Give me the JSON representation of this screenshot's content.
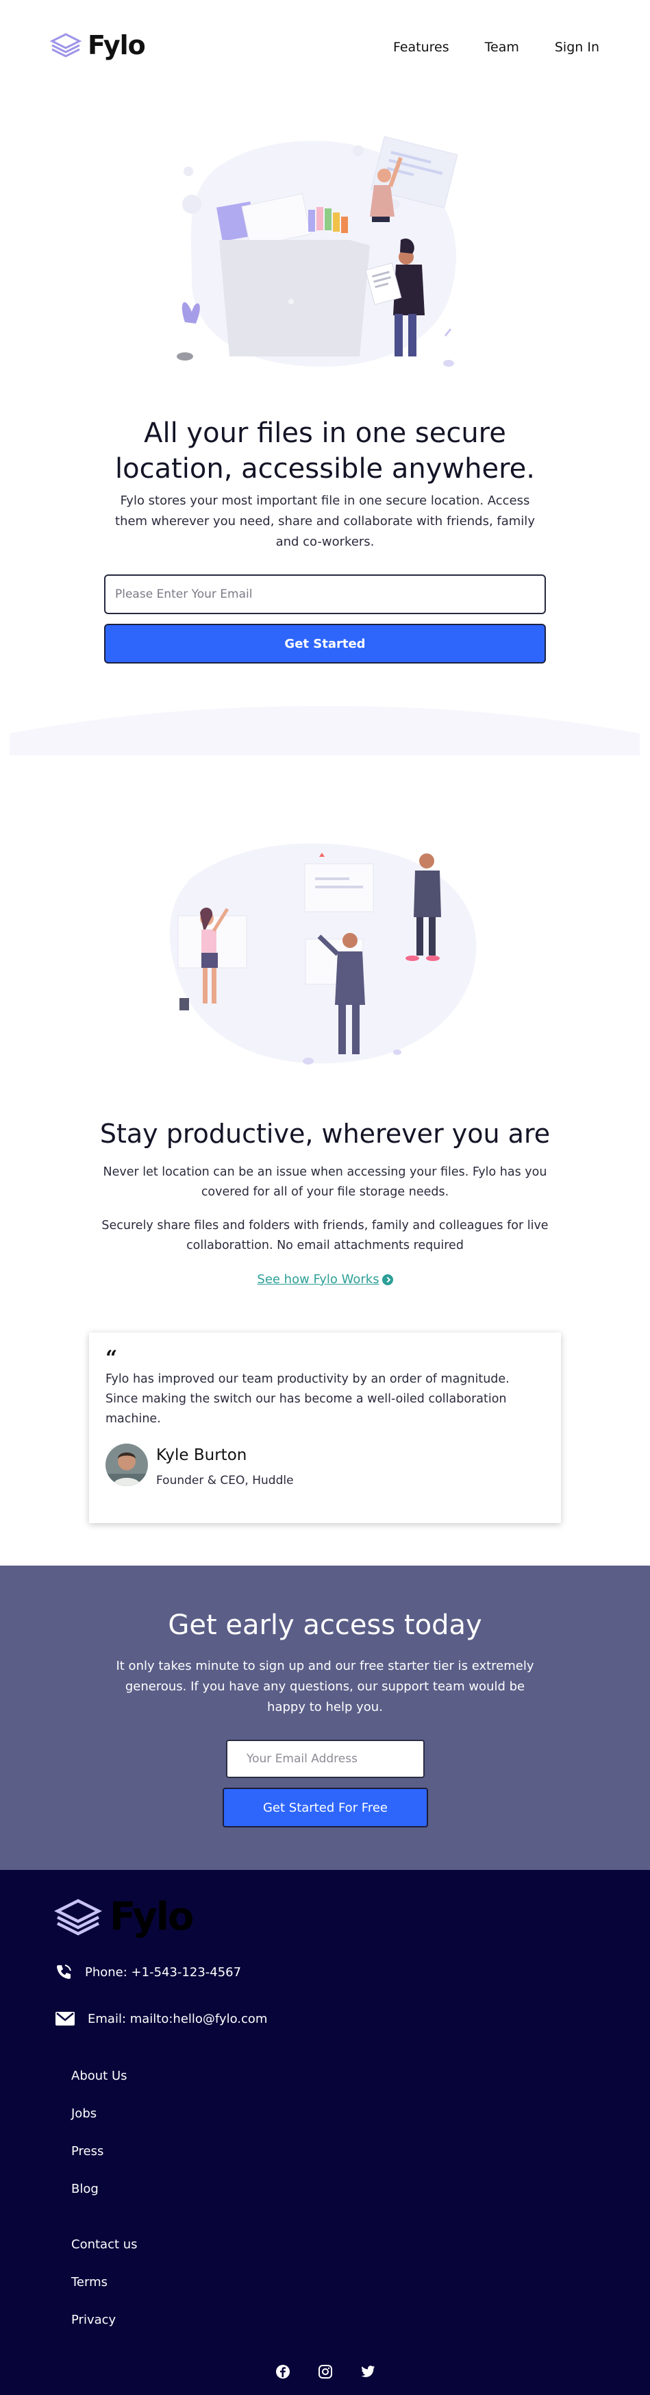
{
  "header": {
    "logo_text": "Fylo",
    "nav": [
      "Features",
      "Team",
      "Sign In"
    ]
  },
  "hero": {
    "title_line1": "All your files in one secure",
    "title_line2": "location, accessible anywhere.",
    "subtitle": "Fylo stores your most important file in one secure location. Access them wherever you need, share and collaborate with friends, family and co-workers.",
    "email_placeholder": "Please Enter Your Email",
    "button_label": "Get Started"
  },
  "productive": {
    "title": "Stay productive, wherever you are",
    "paragraph1": "Never let location can be an issue when accessing your files. Fylo has you covered for all of your file storage needs.",
    "paragraph2": "Securely share files and folders with friends, family and colleagues for live collaborattion. No email attachments required",
    "link_text": "See how Fylo Works"
  },
  "testimonial": {
    "quote_mark": "“",
    "quote": "Fylo has improved our team productivity by an order of magnitude. Since making the switch our has become a well-oiled collaboration machine.",
    "name": "Kyle Burton",
    "role": "Founder & CEO, Huddle"
  },
  "cta": {
    "title": "Get early access today",
    "text": "It only takes minute to sign up and our free starter tier is extremely generous. If you have any questions, our support team would be happy to help you.",
    "email_placeholder": "Your Email Address",
    "button_label": "Get Started For Free"
  },
  "footer": {
    "logo_text": "Fylo",
    "phone": "Phone: +1-543-123-4567",
    "email": "Email: mailto:hello@fylo.com",
    "links_group1": [
      "About Us",
      "Jobs",
      "Press",
      "Blog"
    ],
    "links_group2": [
      "Contact us",
      "Terms",
      "Privacy"
    ],
    "socials": [
      "facebook-icon",
      "instagram-icon",
      "twitter-icon"
    ]
  },
  "colors": {
    "primary_blue": "#2e66fc",
    "cta_bg": "#5b5e87",
    "footer_bg": "#070439",
    "link_teal": "#2c9f97"
  }
}
